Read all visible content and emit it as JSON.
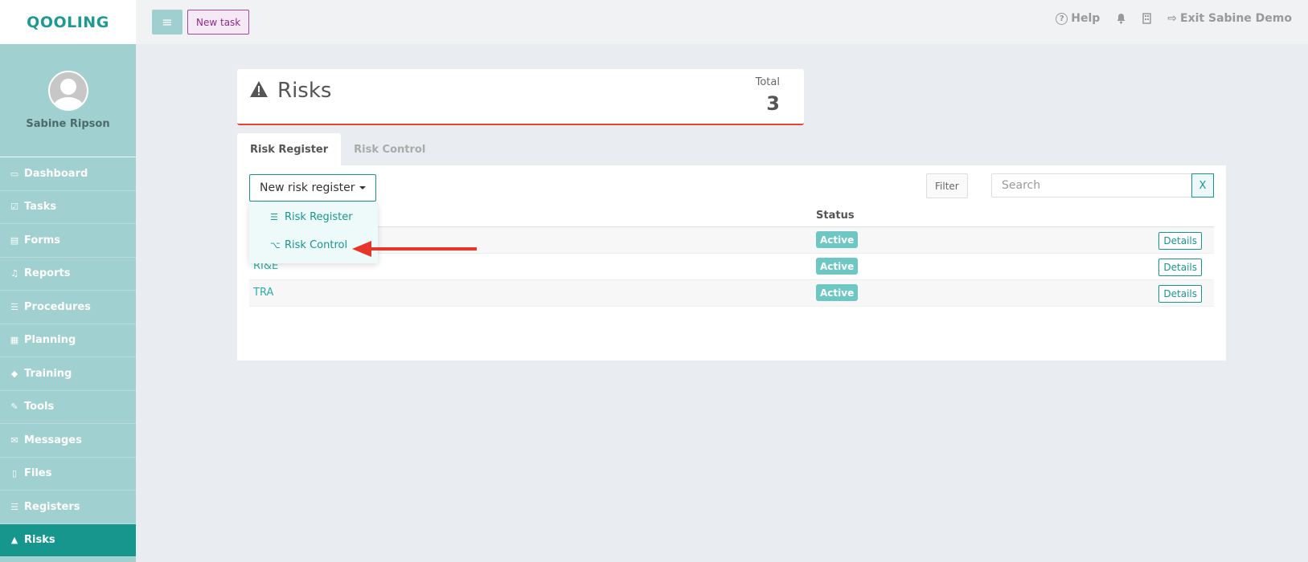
{
  "brand": {
    "logo_text": "QOOLING",
    "accent": "#17968e",
    "sidebar_bg": "#a0d0cf",
    "alert": "#e8452c"
  },
  "profile": {
    "name": "Sabine Ripson"
  },
  "sidebar": {
    "items": [
      {
        "label": "Dashboard",
        "icon": "monitor-icon",
        "glyph": "▭"
      },
      {
        "label": "Tasks",
        "icon": "check-square-icon",
        "glyph": "☑"
      },
      {
        "label": "Forms",
        "icon": "document-icon",
        "glyph": "▤"
      },
      {
        "label": "Reports",
        "icon": "bell-icon",
        "glyph": "♫"
      },
      {
        "label": "Procedures",
        "icon": "list-icon",
        "glyph": "☰"
      },
      {
        "label": "Planning",
        "icon": "calendar-icon",
        "glyph": "▦"
      },
      {
        "label": "Training",
        "icon": "graduation-cap-icon",
        "glyph": "◆"
      },
      {
        "label": "Tools",
        "icon": "wrench-icon",
        "glyph": "✎"
      },
      {
        "label": "Messages",
        "icon": "envelope-icon",
        "glyph": "✉"
      },
      {
        "label": "Files",
        "icon": "file-icon",
        "glyph": "▯"
      },
      {
        "label": "Registers",
        "icon": "list-icon",
        "glyph": "☰"
      },
      {
        "label": "Risks",
        "icon": "warning-icon",
        "glyph": "▲"
      }
    ]
  },
  "topbar": {
    "new_task_label": "New task",
    "help_label": "Help",
    "exit_label": "Exit Sabine Demo",
    "help_glyph": "?",
    "menu_glyph": "≡",
    "bell_glyph": "🔔",
    "building_glyph": "▯",
    "exit_glyph": "⇨"
  },
  "header": {
    "title": "Risks",
    "total_label": "Total",
    "total_value": "3"
  },
  "tabs": [
    {
      "label": "Risk Register"
    },
    {
      "label": "Risk Control"
    }
  ],
  "toolbar": {
    "new_risk_label": "New risk register",
    "filter_label": "Filter",
    "search_placeholder": "Search",
    "clear_label": "X"
  },
  "table": {
    "status_header": "Status",
    "details_label": "Details",
    "rows": [
      {
        "name": "",
        "status": "Active"
      },
      {
        "name": "RI&E",
        "status": "Active"
      },
      {
        "name": "TRA",
        "status": "Active"
      }
    ]
  },
  "dropdown": {
    "items": [
      {
        "label": "Risk Register",
        "icon": "list-icon",
        "glyph": "☰"
      },
      {
        "label": "Risk Control",
        "icon": "fork-icon",
        "glyph": "⌥"
      }
    ]
  }
}
